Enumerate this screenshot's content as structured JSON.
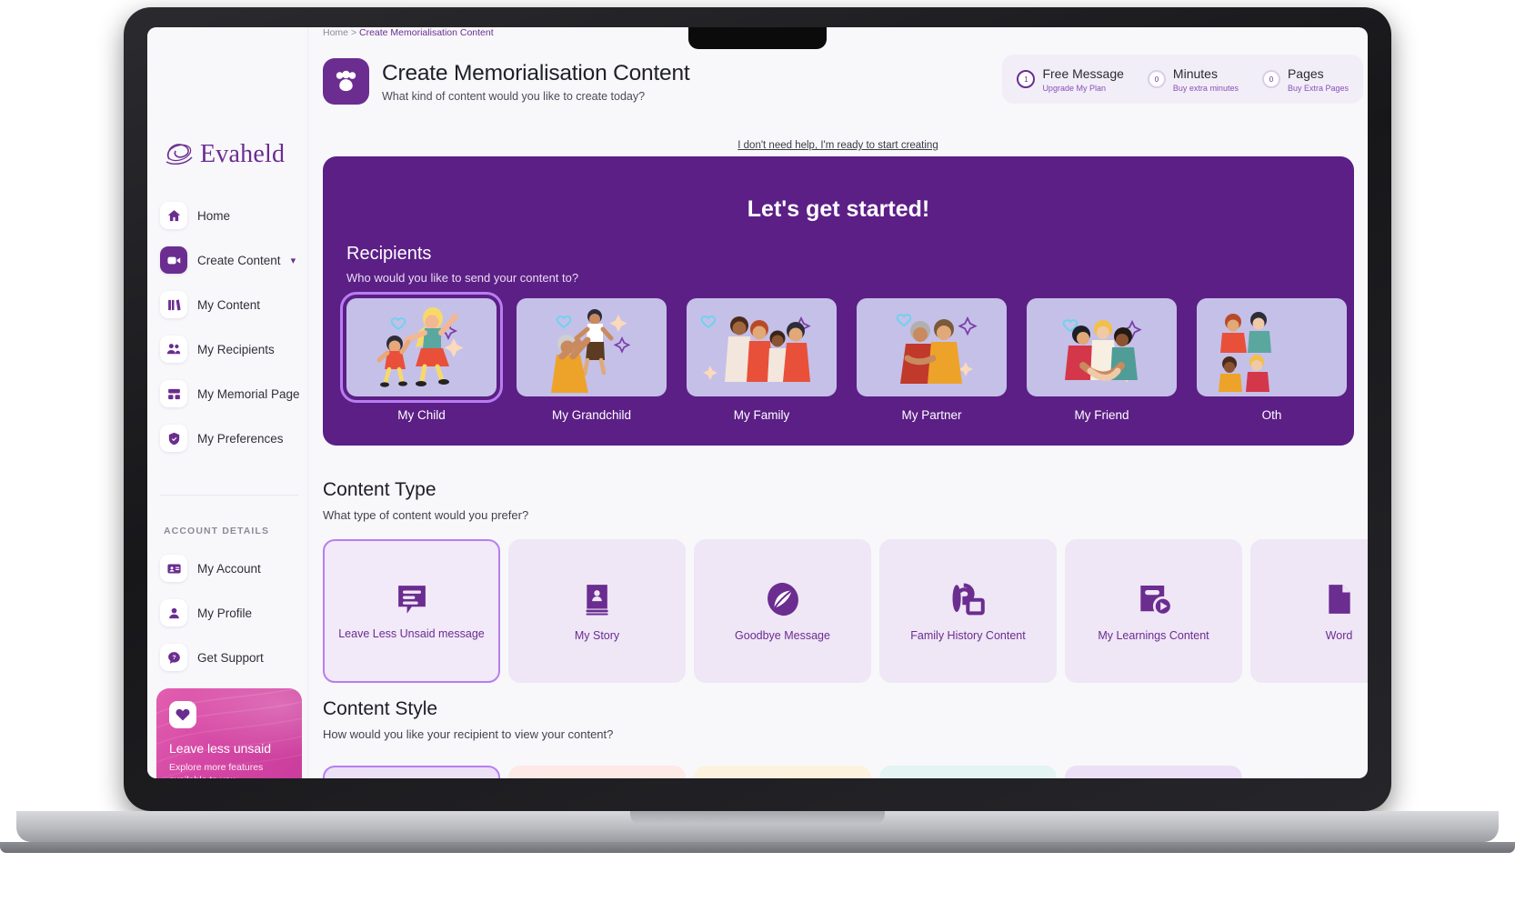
{
  "breadcrumb": {
    "home": "Home",
    "sep": ">",
    "current": "Create Memorialisation Content"
  },
  "header": {
    "icon": "people-group-icon",
    "title": "Create Memorialisation Content",
    "subtitle": "What kind of content would you like to create today?"
  },
  "stats": [
    {
      "count": "1",
      "name": "Free Message",
      "link": "Upgrade My Plan",
      "highlight": true
    },
    {
      "count": "0",
      "name": "Minutes",
      "link": "Buy extra minutes",
      "highlight": false
    },
    {
      "count": "0",
      "name": "Pages",
      "link": "Buy Extra Pages",
      "highlight": false
    }
  ],
  "helper_link": "I don't need help, I'm ready to start creating",
  "sidebar": {
    "brand": "Evaheld",
    "items": [
      {
        "label": "Home",
        "icon": "home-icon",
        "active": false,
        "chevron": false
      },
      {
        "label": "Create Content",
        "icon": "video-camera-icon",
        "active": true,
        "chevron": true
      },
      {
        "label": "My Content",
        "icon": "books-icon",
        "active": false,
        "chevron": false
      },
      {
        "label": "My Recipients",
        "icon": "people-icon",
        "active": false,
        "chevron": false
      },
      {
        "label": "My Memorial Page",
        "icon": "layout-grid-icon",
        "active": false,
        "chevron": false
      },
      {
        "label": "My Preferences",
        "icon": "shield-check-icon",
        "active": false,
        "chevron": false
      }
    ],
    "section_title": "ACCOUNT DETAILS",
    "account_items": [
      {
        "label": "My Account",
        "icon": "id-card-icon"
      },
      {
        "label": "My Profile",
        "icon": "user-icon"
      },
      {
        "label": "Get Support",
        "icon": "help-chat-icon"
      }
    ],
    "promo": {
      "icon": "heart-icon",
      "title": "Leave less unsaid",
      "subtitle": "Explore more features available to you"
    }
  },
  "hero": {
    "title": "Let's get started!",
    "recipients_heading": "Recipients",
    "recipients_sub": "Who would you like to send your content to?",
    "recipients": [
      {
        "label": "My Child",
        "selected": true
      },
      {
        "label": "My Grandchild",
        "selected": false
      },
      {
        "label": "My Family",
        "selected": false
      },
      {
        "label": "My Partner",
        "selected": false
      },
      {
        "label": "My Friend",
        "selected": false
      },
      {
        "label": "Oth",
        "selected": false
      }
    ]
  },
  "content_type": {
    "heading": "Content Type",
    "sub": "What type of content would you prefer?",
    "cards": [
      {
        "label": "Leave Less Unsaid message",
        "icon": "speech-bubble-lines-icon",
        "selected": true
      },
      {
        "label": "My Story",
        "icon": "book-person-icon",
        "selected": false
      },
      {
        "label": "Goodbye Message",
        "icon": "leaf-circle-icon",
        "selected": false
      },
      {
        "label": "Family History Content",
        "icon": "family-tree-icon",
        "selected": false
      },
      {
        "label": "My Learnings Content",
        "icon": "book-play-icon",
        "selected": false
      },
      {
        "label": "Word",
        "icon": "document-icon",
        "selected": false
      }
    ]
  },
  "content_style": {
    "heading": "Content Style",
    "sub": "How would you like your recipient to view your content?",
    "cards": [
      {
        "color": "#ece0f7"
      },
      {
        "color": "#fde9e6"
      },
      {
        "color": "#fdf2dd"
      },
      {
        "color": "#e3f4f2"
      }
    ]
  },
  "colors": {
    "brand_purple": "#6b2d90",
    "hero_purple": "#5c1f86",
    "accent_lilac": "#b87ef0",
    "card_lavender": "#efe6f6",
    "promo_pink": "#d447a4"
  }
}
